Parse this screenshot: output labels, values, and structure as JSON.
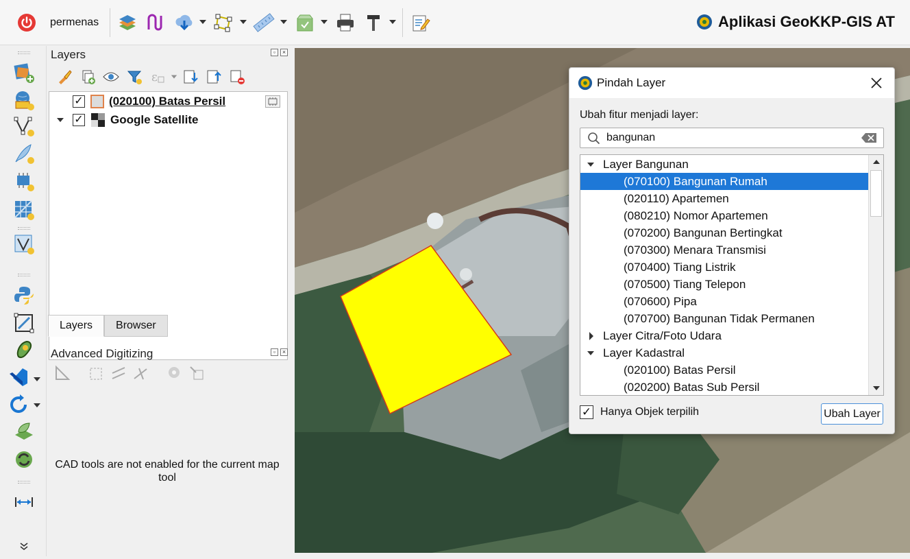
{
  "toolbar": {
    "user": "permenas",
    "title": "Aplikasi GeoKKP-GIS AT",
    "icons": [
      "power-icon",
      "layer-stack-icon",
      "digitize-line-icon",
      "download-icon",
      "polygon-vertex-icon",
      "ruler-icon",
      "package-icon",
      "print-icon",
      "hammer-icon",
      "edit-notes-icon"
    ]
  },
  "layers_panel": {
    "title": "Layers",
    "layers": [
      {
        "name": "(020100) Batas Persil",
        "checked": true
      },
      {
        "name": "Google Satellite",
        "checked": true
      }
    ],
    "tabs": [
      "Layers",
      "Browser"
    ]
  },
  "adv_panel": {
    "title": "Advanced Digitizing",
    "message": "CAD tools are not enabled for the current map tool"
  },
  "dialog": {
    "title": "Pindah Layer",
    "label": "Ubah fitur menjadi layer:",
    "search_value": "bangunan",
    "groups": [
      {
        "name": "Layer Bangunan",
        "expanded": true,
        "items": [
          "(070100) Bangunan Rumah",
          "(020110) Apartemen",
          "(080210) Nomor Apartemen",
          "(070200) Bangunan Bertingkat",
          "(070300) Menara Transmisi",
          "(070400) Tiang Listrik",
          "(070500) Tiang Telepon",
          "(070600) Pipa",
          "(070700) Bangunan Tidak Permanen"
        ]
      },
      {
        "name": "Layer Citra/Foto Udara",
        "expanded": false,
        "items": []
      },
      {
        "name": "Layer Kadastral",
        "expanded": true,
        "items": [
          "(020100) Batas Persil",
          "(020200) Batas Sub Persil"
        ]
      }
    ],
    "selected_item": "(070100) Bangunan Rumah",
    "checkbox_label": "Hanya Objek terpilih",
    "checkbox_checked": true,
    "button_label": "Ubah Layer"
  },
  "map": {
    "polygon_fill": "#ffff00",
    "polygon_stroke": "#d43a1a"
  }
}
